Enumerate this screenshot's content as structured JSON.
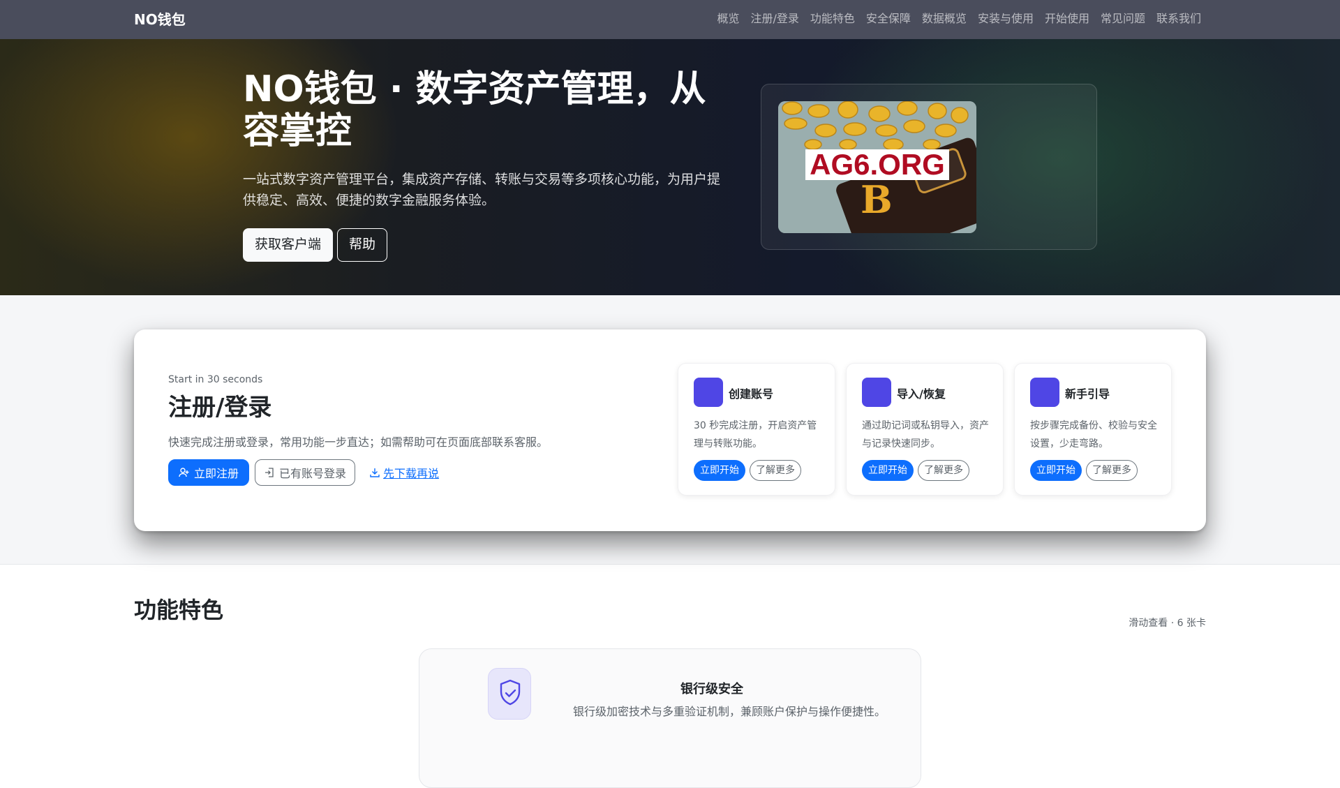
{
  "nav": {
    "brand": "NO钱包",
    "links": [
      "概览",
      "注册/登录",
      "功能特色",
      "安全保障",
      "数据概览",
      "安装与使用",
      "开始使用",
      "常见问题",
      "联系我们"
    ]
  },
  "hero": {
    "title": "NO钱包 · 数字资产管理，从容掌控",
    "description": "一站式数字资产管理平台，集成资产存储、转账与交易等多项核心功能，为用户提供稳定、高效、便捷的数字金融服务体验。",
    "primary_button": "获取客户端",
    "secondary_button": "帮助",
    "image_label": "AG6.ORG"
  },
  "register": {
    "eyebrow": "Start in 30 seconds",
    "title": "注册/登录",
    "description": "快速完成注册或登录，常用功能一步直达；如需帮助可在页面底部联系客服。",
    "register_button": "立即注册",
    "login_button": "已有账号登录",
    "download_link": "先下载再说",
    "cards": [
      {
        "title": "创建账号",
        "description": "30 秒完成注册，开启资产管理与转账功能。",
        "start": "立即开始",
        "more": "了解更多"
      },
      {
        "title": "导入/恢复",
        "description": "通过助记词或私钥导入，资产与记录快速同步。",
        "start": "立即开始",
        "more": "了解更多"
      },
      {
        "title": "新手引导",
        "description": "按步骤完成备份、校验与安全设置，少走弯路。",
        "start": "立即开始",
        "more": "了解更多"
      }
    ]
  },
  "features": {
    "title": "功能特色",
    "hint": "滑动查看 · 6 张卡",
    "card": {
      "title": "银行级安全",
      "description": "银行级加密技术与多重验证机制，兼顾账户保护与操作便捷性。"
    }
  },
  "colors": {
    "accent": "#0d6efd",
    "icon_purple": "#4f46e5",
    "navbar": "#4a4d5c"
  }
}
